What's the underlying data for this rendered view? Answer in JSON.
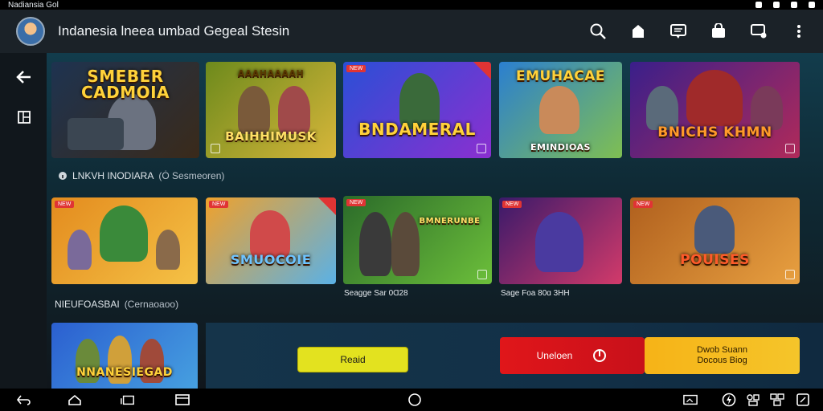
{
  "status_bar": {
    "left_text": "Nadiansia Gol"
  },
  "app_bar": {
    "title": "Indanesia lneea umbad Gegeal Stesin",
    "actions": [
      "search-icon",
      "store-icon",
      "message-icon",
      "bag-icon",
      "chat-icon",
      "more-vert-icon"
    ]
  },
  "sidebar": {
    "items": [
      "back-arrow-icon",
      "library-icon"
    ]
  },
  "row1": {
    "cards": [
      {
        "title": "SMEBER CADMOIA",
        "colors": [
          "#1e3350",
          "#3a2a1a"
        ],
        "title_color": "#ffd23a"
      },
      {
        "title": "BAIHHIMUSK",
        "top_title": "AAAHAAAAH",
        "colors": [
          "#6d8a1c",
          "#d7b63a"
        ],
        "title_color": "#ffe066"
      },
      {
        "title": "BNDAMERAL",
        "colors": [
          "#2a4fd6",
          "#8b2fd0"
        ],
        "title_color": "#ffd23a"
      },
      {
        "title": "EMUHACAE",
        "subtitle": "EMINDIOAS",
        "colors": [
          "#2b7fd0",
          "#7fbf52"
        ],
        "title_color": "#ffd23a"
      },
      {
        "title": "BNICHS KHMN",
        "colors": [
          "#3a1f8a",
          "#b02a5a"
        ],
        "title_color": "#ff9a2a"
      }
    ]
  },
  "section1": {
    "icon": "info-icon",
    "label": "LNKVH INODIARA",
    "muted": "(Ȯ Sesmeoren)"
  },
  "row2": {
    "cards": [
      {
        "title": "",
        "colors": [
          "#e38b1e",
          "#f5c246"
        ],
        "title_color": "#ffd23a"
      },
      {
        "title": "SMUOCOIE",
        "colors": [
          "#f0a12b",
          "#5ab1e6"
        ],
        "title_color": "#6ec4ff"
      },
      {
        "title": "BMNERUNBE",
        "colors": [
          "#2b6b2a",
          "#6cbf3a"
        ],
        "title_color": "#ffe066"
      },
      {
        "title": "",
        "colors": [
          "#3a1a6a",
          "#d23a6a"
        ],
        "title_color": "#ffd23a"
      },
      {
        "title": "POUISES",
        "colors": [
          "#b0601e",
          "#e8a040"
        ],
        "title_color": "#ff5a2a"
      }
    ],
    "captions": [
      "Seagge Sar 0Ɑ28",
      "Sage Foa 80ɑ 3HH"
    ]
  },
  "section2": {
    "label": "NIEUFOASBAI",
    "muted": "(Cernaoaoo)"
  },
  "row3": {
    "card": {
      "title": "NNANESIEGAD",
      "colors": [
        "#2b5fd0",
        "#46a0e0"
      ],
      "title_color": "#ffd23a"
    }
  },
  "banner": {
    "left_button": "Reaid",
    "red_button": "Uneloen",
    "yellow_button_line1": "Dwob Suann",
    "yellow_button_line2": "Docous Biog"
  },
  "nav_bar": [
    "back-icon",
    "home-icon",
    "recents-icon",
    "window-icon",
    "circle-home-icon",
    "screenshot-icon",
    "assistant-icon",
    "settings-icon",
    "copy-icon"
  ]
}
